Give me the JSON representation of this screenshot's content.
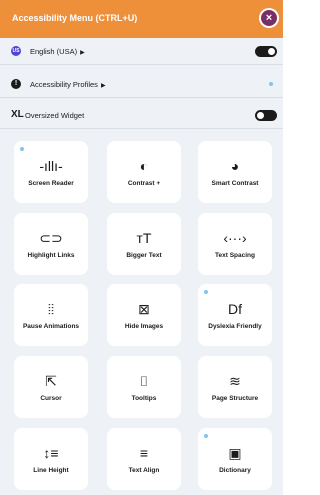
{
  "header": {
    "title": "Accessibility Menu (CTRL+U)"
  },
  "language": {
    "label": "English (USA)",
    "badge": "US"
  },
  "profiles": {
    "label": "Accessibility Profiles"
  },
  "oversized": {
    "prefix": "XL",
    "label": "Oversized Widget"
  },
  "features": [
    {
      "label": "Screen Reader",
      "icon": "waveform-icon",
      "glyph": "-ıllı-",
      "dot": true
    },
    {
      "label": "Contrast +",
      "icon": "contrast-icon",
      "glyph": "◐",
      "dot": false
    },
    {
      "label": "Smart Contrast",
      "icon": "smart-contrast-icon",
      "glyph": "◕",
      "dot": false
    },
    {
      "label": "Highlight Links",
      "icon": "link-icon",
      "glyph": "⊂⊃",
      "dot": false
    },
    {
      "label": "Bigger Text",
      "icon": "bigger-text-icon",
      "glyph": "тT",
      "dot": false
    },
    {
      "label": "Text Spacing",
      "icon": "text-spacing-icon",
      "glyph": "‹···›",
      "dot": false
    },
    {
      "label": "Pause Animations",
      "icon": "pause-icon",
      "glyph": "⦙⦙",
      "dot": false
    },
    {
      "label": "Hide Images",
      "icon": "hide-images-icon",
      "glyph": "⊠",
      "dot": false
    },
    {
      "label": "Dyslexia Friendly",
      "icon": "dyslexia-icon",
      "glyph": "Df",
      "dot": true
    },
    {
      "label": "Cursor",
      "icon": "cursor-icon",
      "glyph": "⇱",
      "dot": false
    },
    {
      "label": "Tooltips",
      "icon": "tooltip-icon",
      "glyph": "⌷",
      "dot": false
    },
    {
      "label": "Page Structure",
      "icon": "page-structure-icon",
      "glyph": "≋",
      "dot": false
    },
    {
      "label": "Line Height",
      "icon": "line-height-icon",
      "glyph": "↕≡",
      "dot": false
    },
    {
      "label": "Text Align",
      "icon": "text-align-icon",
      "glyph": "≡",
      "dot": false
    },
    {
      "label": "Dictionary",
      "icon": "dictionary-icon",
      "glyph": "▣",
      "dot": true
    }
  ],
  "colors": {
    "header": "#ee8f3a",
    "background": "#eef2f6",
    "accent_dot": "#7fc6ea",
    "close_inner": "#7b2e63"
  }
}
